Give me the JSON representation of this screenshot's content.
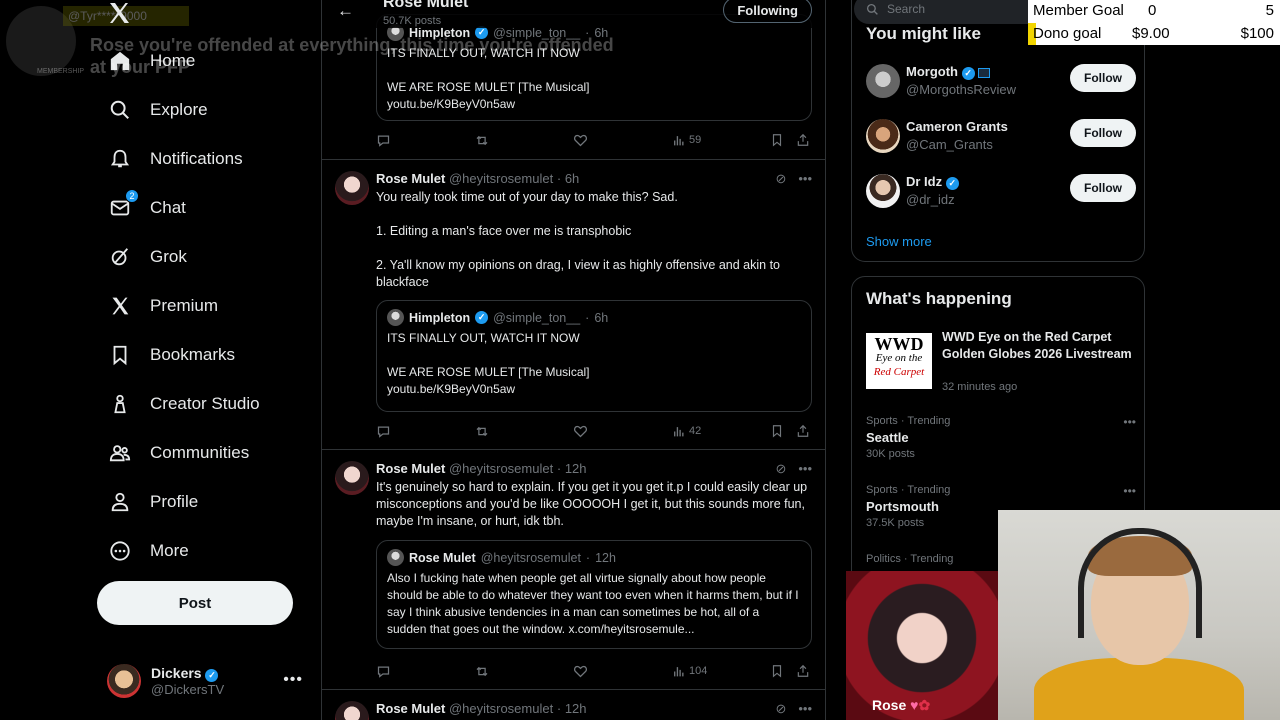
{
  "overlay": {
    "tag": "@Tyr*****9000",
    "membership": "MEMBERSHIP",
    "message": "Rose you're offended at everything, this time you're offended at your PFP"
  },
  "nav": {
    "items": [
      {
        "label": "Home",
        "icon": "home-icon"
      },
      {
        "label": "Explore",
        "icon": "search-icon"
      },
      {
        "label": "Notifications",
        "icon": "bell-icon"
      },
      {
        "label": "Chat",
        "icon": "chat-icon",
        "badge": "2"
      },
      {
        "label": "Grok",
        "icon": "grok-icon"
      },
      {
        "label": "Premium",
        "icon": "x-icon"
      },
      {
        "label": "Bookmarks",
        "icon": "bookmark-icon"
      },
      {
        "label": "Creator Studio",
        "icon": "creator-studio-icon"
      },
      {
        "label": "Communities",
        "icon": "communities-icon"
      },
      {
        "label": "Profile",
        "icon": "profile-icon"
      },
      {
        "label": "More",
        "icon": "more-circle-icon"
      }
    ],
    "post_label": "Post",
    "account": {
      "name": "Dickers",
      "handle": "@DickersTV"
    }
  },
  "header": {
    "title": "Rose Mulet",
    "posts": "50.7K posts",
    "following_label": "Following"
  },
  "tweets": [
    {
      "quote": {
        "name": "Himpleton",
        "handle": "@simple_ton__",
        "time": "6h",
        "line1": "ITS FINALLY OUT, WATCH IT NOW",
        "line2": "WE ARE ROSE MULET [The Musical]",
        "line3": "youtu.be/K9BeyV0n5aw"
      },
      "views": "59"
    },
    {
      "name": "Rose Mulet",
      "handle": "@heyitsrosemulet",
      "time": "6h",
      "p1": "You really took time out of your day to make this? Sad.",
      "p2": "1. Editing a man's face over me is transphobic",
      "p3": "2. Ya'll know my opinions on drag, I view it as highly offensive and akin to blackface",
      "quote": {
        "name": "Himpleton",
        "handle": "@simple_ton__",
        "time": "6h",
        "line1": "ITS FINALLY OUT, WATCH IT NOW",
        "line2": "WE ARE ROSE MULET [The Musical]",
        "line3": "youtu.be/K9BeyV0n5aw"
      },
      "views": "42"
    },
    {
      "name": "Rose Mulet",
      "handle": "@heyitsrosemulet",
      "time": "12h",
      "p1": "It's genuinely so hard to explain. If you get it you get it.p I could easily clear up misconceptions and you'd be like OOOOOH I get it, but this sounds more fun, maybe I'm insane, or hurt, idk tbh.",
      "quote": {
        "name": "Rose Mulet",
        "handle": "@heyitsrosemulet",
        "time": "12h",
        "text": "Also I fucking hate when people get all virtue signally about how people should be able to do whatever they want too even when it harms them, but if I say I think abusive tendencies in a man can sometimes be hot, all of a sudden that goes out the window. x.com/heyitsrosemule..."
      },
      "views": "104"
    },
    {
      "name": "Rose Mulet",
      "handle": "@heyitsrosemulet",
      "time": "12h"
    }
  ],
  "right": {
    "search_placeholder": "Search",
    "wtf_title": "You might like",
    "wtf": [
      {
        "name": "Morgoth",
        "handle": "@MorgothsReview",
        "follow": "Follow"
      },
      {
        "name": "Cameron Grants",
        "handle": "@Cam_Grants",
        "follow": "Follow"
      },
      {
        "name": "Dr Idz",
        "handle": "@dr_idz",
        "follow": "Follow"
      }
    ],
    "show_more": "Show more",
    "happening_title": "What's happening",
    "event": {
      "logo1": "WWD",
      "logo2": "Eye on the",
      "logo3": "Red Carpet",
      "title": "WWD Eye on the Red Carpet Golden Globes 2026 Livestream",
      "time": "32 minutes ago"
    },
    "trends": [
      {
        "meta": "Sports · Trending",
        "name": "Seattle",
        "count": "30K posts"
      },
      {
        "meta": "Sports · Trending",
        "name": "Portsmouth",
        "count": "37.5K posts"
      },
      {
        "meta": "Politics · Trending",
        "name": "",
        "count": ""
      }
    ]
  },
  "goals": {
    "member_label": "Member Goal",
    "member_current": "0",
    "member_target": "5",
    "dono_label": "Dono goal",
    "dono_current": "$9.00",
    "dono_target": "$100"
  },
  "webcam": {
    "rose_label": "Rose"
  }
}
